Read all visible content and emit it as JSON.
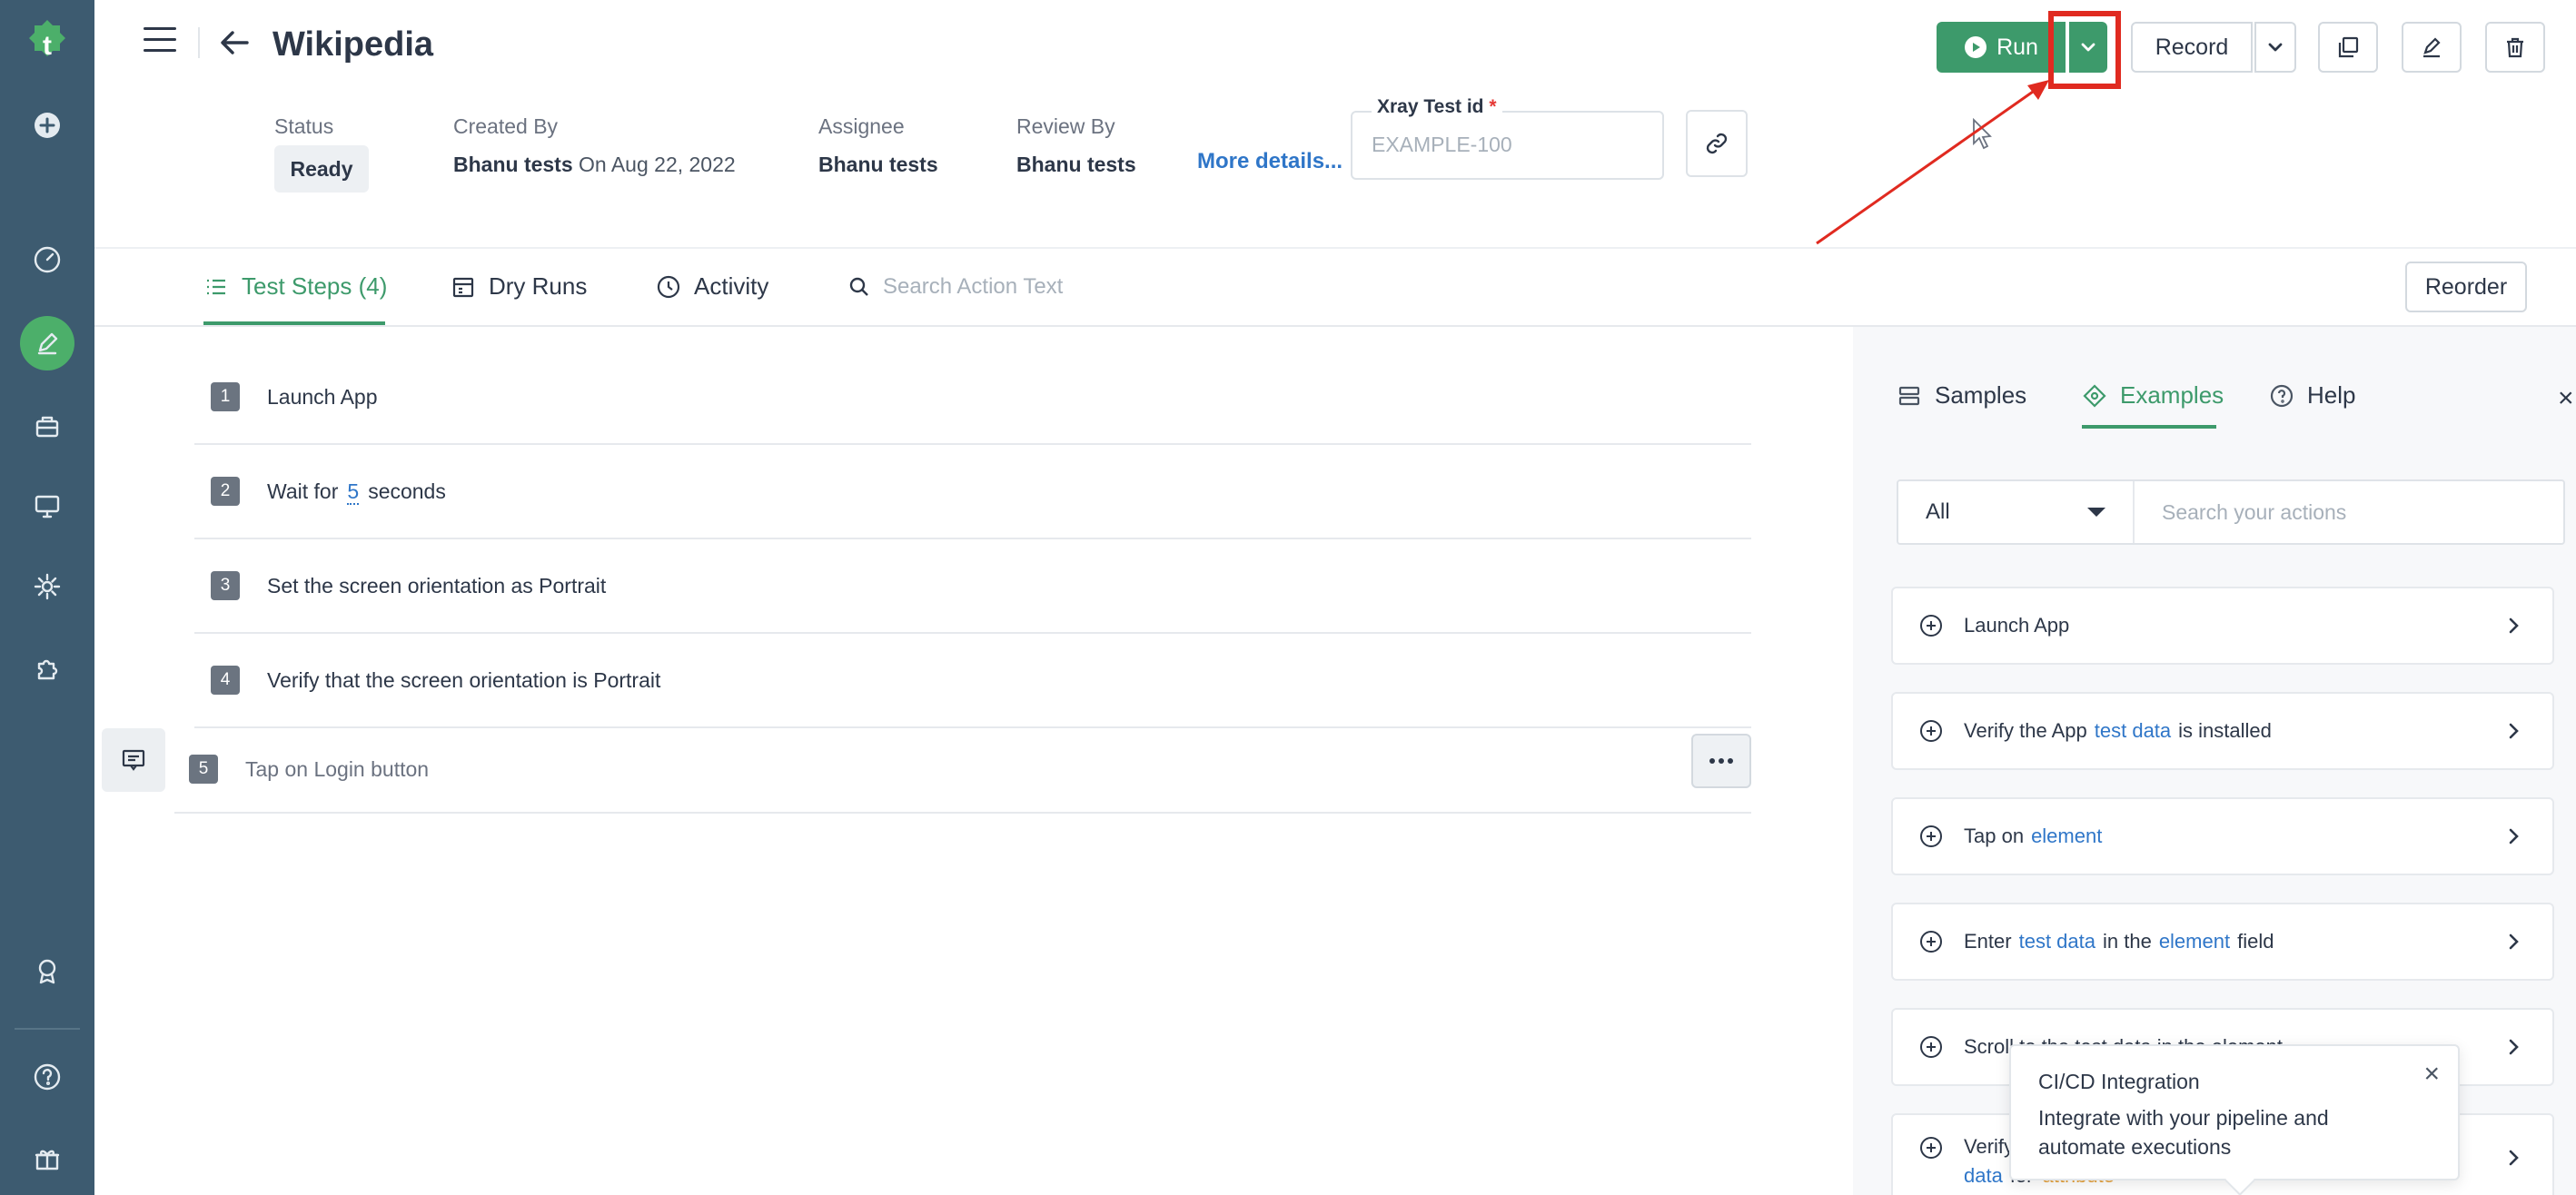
{
  "header": {
    "title": "Wikipedia",
    "status_label": "Status",
    "status_value": "Ready",
    "created_by_label": "Created By",
    "created_by_value": "Bhanu tests",
    "created_on": "On Aug 22, 2022",
    "assignee_label": "Assignee",
    "assignee_value": "Bhanu tests",
    "review_by_label": "Review By",
    "review_by_value": "Bhanu tests",
    "more_details": "More details...",
    "xray_label": "Xray Test id",
    "xray_required": "*",
    "xray_placeholder": "EXAMPLE-100"
  },
  "toolbar": {
    "run_label": "Run",
    "record_label": "Record"
  },
  "tabs": {
    "test_steps": "Test Steps (4)",
    "dry_runs": "Dry Runs",
    "activity": "Activity",
    "search_placeholder": "Search Action Text",
    "reorder": "Reorder"
  },
  "steps": [
    {
      "num": "1",
      "text": "Launch App"
    },
    {
      "num": "2",
      "pre": "Wait for",
      "param": "5",
      "post": "seconds"
    },
    {
      "num": "3",
      "text": "Set the screen orientation as Portrait"
    },
    {
      "num": "4",
      "text": "Verify that the screen orientation is Portrait"
    }
  ],
  "new_step": {
    "num": "5",
    "text": "Tap on Login button"
  },
  "right_panel": {
    "tab_samples": "Samples",
    "tab_examples": "Examples",
    "tab_help": "Help",
    "close": "×",
    "filter_value": "All",
    "search_placeholder": "Search your actions",
    "actions": [
      {
        "text": "Launch App"
      },
      {
        "pre": "Verify the App",
        "param": "test data",
        "post": "is installed"
      },
      {
        "pre": "Tap on",
        "param": "element",
        "post": ""
      },
      {
        "pre": "Enter",
        "param": "test data",
        "mid": "in the",
        "param2": "element",
        "post": "field"
      },
      {
        "text": "Scroll to the test data in the element"
      },
      {
        "pre": "Verify",
        "line2_param": "data",
        "line2_mid": "for",
        "line2_attr": "attribute"
      }
    ]
  },
  "tooltip": {
    "title": "CI/CD Integration",
    "description": "Integrate with your pipeline and automate executions",
    "close": "×"
  },
  "colors": {
    "sidebar": "#3d5b70",
    "accent": "#3d9a6b",
    "link": "#2f76c8",
    "annotation": "#e02a20"
  }
}
